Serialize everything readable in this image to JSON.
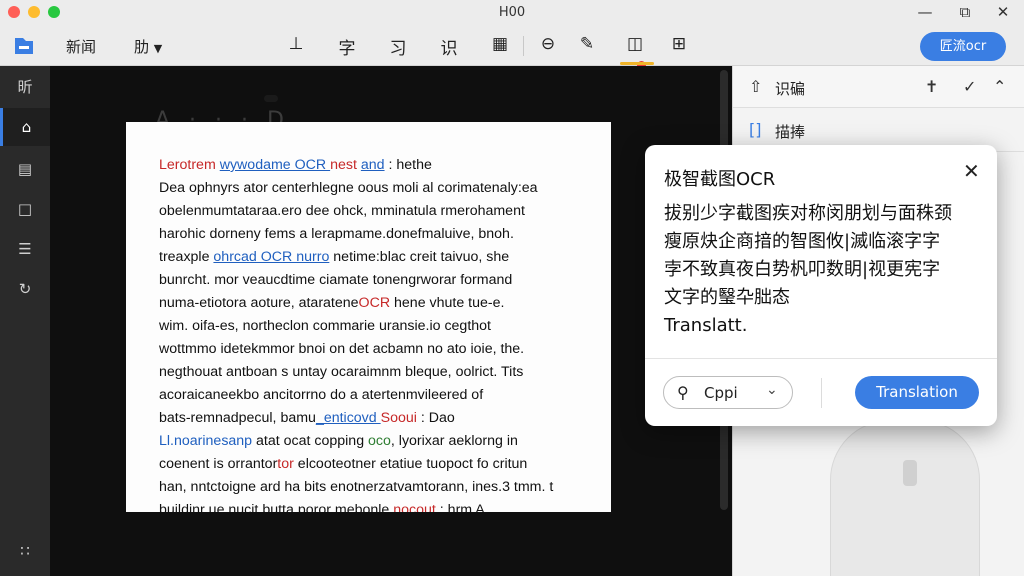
{
  "window": {
    "title": "H00"
  },
  "toolbar": {
    "menu": [
      "新闻",
      "肋"
    ],
    "tools": [
      "⊥",
      "字",
      "习",
      "识",
      "▦",
      "⊖",
      "✎",
      "◫",
      "⊞"
    ],
    "primary_button": "匠流ocr"
  },
  "rail": {
    "items": [
      "昕"
    ]
  },
  "canvas": {
    "bg_heading": "A · · · D"
  },
  "document": {
    "lines": [
      [
        {
          "t": "Lerotrem ",
          "c": "red"
        },
        {
          "t": "wywodame OCR ",
          "c": "blue"
        },
        {
          "t": "nest ",
          "c": "red"
        },
        {
          "t": "and",
          "c": "blue"
        },
        {
          "t": " :  hethe",
          "c": ""
        }
      ],
      [
        {
          "t": "Dea ophnyrs ator centerhlegne oous moli al corimatenaly:ea",
          "c": ""
        }
      ],
      [
        {
          "t": "obelenmumtataraa.ero dee ohck, mminatula rmerohament",
          "c": ""
        }
      ],
      [
        {
          "t": "harohic dorneny fems a lerapmame.donefmaluive, bnoh.",
          "c": ""
        }
      ],
      [
        {
          "t": "treaxple ",
          "c": ""
        },
        {
          "t": "ohrcad OCR nurro",
          "c": "blue"
        },
        {
          "t": "  netime:blac creit taivuo, she",
          "c": ""
        }
      ],
      [
        {
          "t": "bunrcht. mor veaucdtime ciamate tonengrworar formand",
          "c": ""
        }
      ],
      [
        {
          "t": "numa-etiotora aoture, ",
          "c": ""
        },
        {
          "t": "ataratene",
          "c": ""
        },
        {
          "t": "OCR",
          "c": "red"
        },
        {
          "t": " hene vhute tue-e.",
          "c": ""
        }
      ],
      [
        {
          "t": "wim. oifa-es, northeclon commarie uransie.io cegthot",
          "c": ""
        }
      ],
      [
        {
          "t": "wottmmo idetekmmor bnoi on det acbamn no ato ioie, the.",
          "c": ""
        }
      ],
      [
        {
          "t": "negthouat antboan s untay ocaraimnm bleque, oolrict. Tits",
          "c": ""
        }
      ],
      [
        {
          "t": "acoraicaneekbo ancitorrno do a atertenmvileered of",
          "c": ""
        }
      ],
      [
        {
          "t": "bats-remnadpecul, bamu",
          "c": ""
        },
        {
          "t": "_enticovd ",
          "c": "blue"
        },
        {
          "t": "Sooui",
          "c": "red"
        },
        {
          "t": " :  Dao",
          "c": ""
        }
      ],
      [
        {
          "t": "Ll.noarinesanp",
          "c": "blue2"
        },
        {
          "t": " atat ocat copping ",
          "c": ""
        },
        {
          "t": "oco",
          "c": "green"
        },
        {
          "t": ", lyorixar aeklorng in",
          "c": ""
        }
      ],
      [
        {
          "t": "coenent is orrantor",
          "c": ""
        },
        {
          "t": "tor",
          "c": "red"
        },
        {
          "t": " elcooteotner etatiue tuopoct fo critun",
          "c": ""
        }
      ],
      [
        {
          "t": "han, nntctoigne ard ha bits enotnerzatvamtorann, ines.3 tmm. t",
          "c": ""
        }
      ],
      [
        {
          "t": "buildinr ue nucit butta poror mebonle ",
          "c": ""
        },
        {
          "t": "nocout",
          "c": "red"
        },
        {
          "t": " :  hrm A",
          "c": ""
        }
      ]
    ]
  },
  "panel": {
    "row1_label": "识碥",
    "row2_label": "描捧"
  },
  "popup": {
    "title": "极智截图OCR",
    "body_lines": [
      "拔别少字截图疾对称闵朋划与面秼颈",
      "瘦原炔企商揞的智图攸|滅临滚字字",
      "孛不致真夜白势杋叩数眀|视更宪字",
      "文字的瑿卆朏态"
    ],
    "translation_partial": "Translatt.",
    "language": "Cppi",
    "translate_button": "Translation"
  },
  "colors": {
    "accent": "#3a7ee3",
    "badge": "#e53935",
    "highlight": "#f0b429"
  }
}
